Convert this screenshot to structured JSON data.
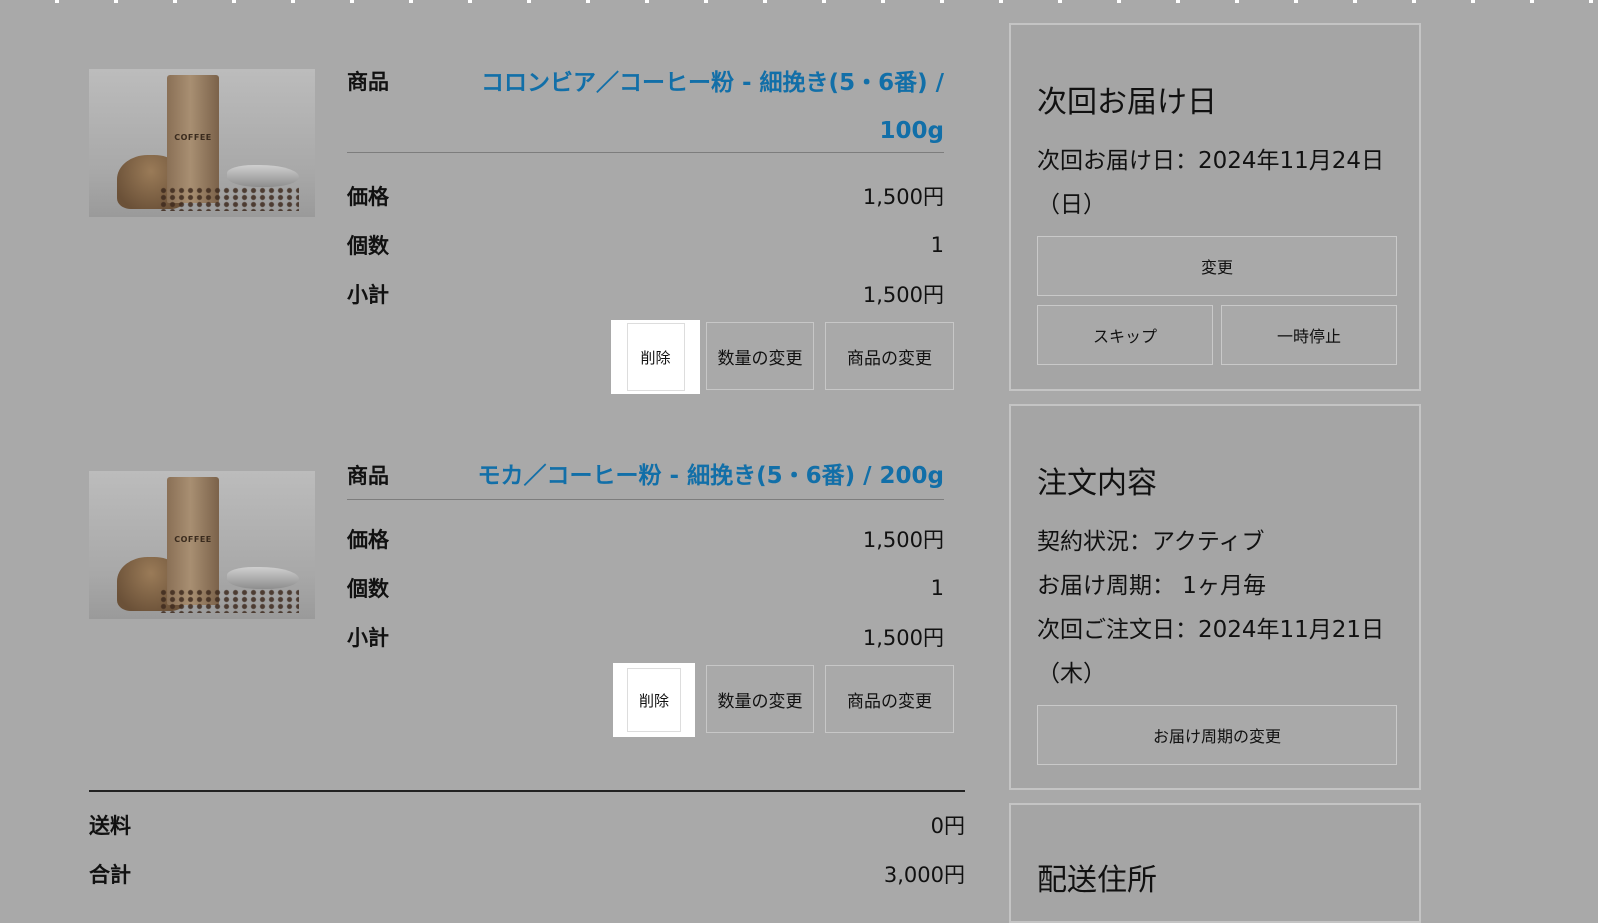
{
  "items": [
    {
      "image": {
        "icon": "coffee-bag-image",
        "bag_text": "COFFEE"
      },
      "product_label": "商品",
      "product_name": "コロンビア／コーヒー粉 - 細挽き(5・6番) / 100g",
      "price_label": "価格",
      "price": "1,500円",
      "qty_label": "個数",
      "qty": "1",
      "subtotal_label": "小計",
      "subtotal": "1,500円",
      "buttons": {
        "delete": "削除",
        "change_qty": "数量の変更",
        "change_product": "商品の変更"
      }
    },
    {
      "image": {
        "icon": "coffee-bag-image",
        "bag_text": "COFFEE"
      },
      "product_label": "商品",
      "product_name": "モカ／コーヒー粉 - 細挽き(5・6番) / 200g",
      "price_label": "価格",
      "price": "1,500円",
      "qty_label": "個数",
      "qty": "1",
      "subtotal_label": "小計",
      "subtotal": "1,500円",
      "buttons": {
        "delete": "削除",
        "change_qty": "数量の変更",
        "change_product": "商品の変更"
      }
    }
  ],
  "totals": {
    "shipping_label": "送料",
    "shipping": "0円",
    "total_label": "合計",
    "total": "3,000円"
  },
  "sidebar": {
    "next_delivery": {
      "title": "次回お届け日",
      "text": "次回お届け日：2024年11月24日（日）",
      "change_button": "変更",
      "skip_button": "スキップ",
      "pause_button": "一時停止"
    },
    "order": {
      "title": "注文内容",
      "status": "契約状況：アクティブ",
      "cycle": "お届け周期： 1ヶ月毎",
      "next_order": "次回ご注文日：2024年11月21日（木）",
      "change_cycle_button": "お届け周期の変更"
    },
    "shipping_address": {
      "title": "配送住所"
    }
  },
  "colors": {
    "background": "#a9a9a9",
    "link": "#126fa8",
    "highlight": "#ffffff"
  }
}
